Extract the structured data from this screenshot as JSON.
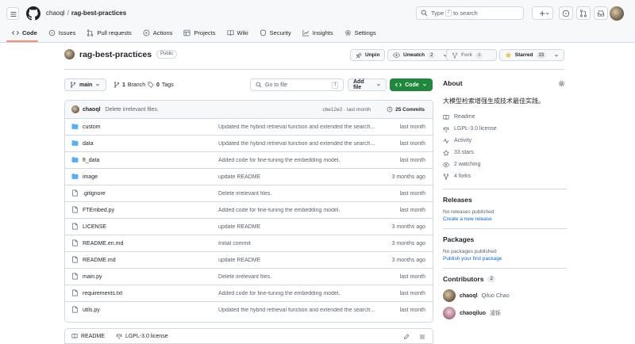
{
  "header": {
    "owner": "chaoql",
    "separator": "/",
    "repo": "rag-best-practices",
    "search_prefix": "Type",
    "search_key": "/",
    "search_suffix": "to search"
  },
  "tabs": [
    {
      "label": "Code",
      "icon": "code-icon"
    },
    {
      "label": "Issues",
      "icon": "issue-icon"
    },
    {
      "label": "Pull requests",
      "icon": "pull-request-icon"
    },
    {
      "label": "Actions",
      "icon": "play-icon"
    },
    {
      "label": "Projects",
      "icon": "table-icon"
    },
    {
      "label": "Wiki",
      "icon": "book-icon"
    },
    {
      "label": "Security",
      "icon": "shield-icon"
    },
    {
      "label": "Insights",
      "icon": "graph-icon"
    },
    {
      "label": "Settings",
      "icon": "gear-icon"
    }
  ],
  "repo": {
    "name": "rag-best-practices",
    "visibility": "Public",
    "unpin": "Unpin",
    "unwatch": "Unwatch",
    "watch_count": "2",
    "fork": "Fork",
    "fork_count": "4",
    "starred": "Starred",
    "star_count": "33"
  },
  "toolbar": {
    "branch": "main",
    "branches_num": "1",
    "branches_label": "Branch",
    "tags_num": "0",
    "tags_label": "Tags",
    "goto_placeholder": "Go to file",
    "goto_key": "t",
    "add_file": "Add file",
    "code": "Code"
  },
  "commit": {
    "author": "chaoql",
    "message": "Delete irrelevant files.",
    "meta": "cbe12e2 · last month",
    "count_label": "25 Commits"
  },
  "files": [
    {
      "name": "custom",
      "type": "dir",
      "message": "Updated the hybrid retrieval function and extended the search...",
      "date": "last month"
    },
    {
      "name": "data",
      "type": "dir",
      "message": "Updated the hybrid retrieval function and extended the search...",
      "date": "last month"
    },
    {
      "name": "ft_data",
      "type": "dir",
      "message": "Added code for fine-tuning the embedding model.",
      "date": "last month"
    },
    {
      "name": "image",
      "type": "dir",
      "message": "update README",
      "date": "3 months ago"
    },
    {
      "name": ".gitignore",
      "type": "file",
      "message": "Delete irrelevant files.",
      "date": "last month"
    },
    {
      "name": "FTEmbed.py",
      "type": "file",
      "message": "Added code for fine-tuning the embedding model.",
      "date": "last month"
    },
    {
      "name": "LICENSE",
      "type": "file",
      "message": "update README",
      "date": "3 months ago"
    },
    {
      "name": "README.en.md",
      "type": "file",
      "message": "Initial commit",
      "date": "3 months ago"
    },
    {
      "name": "README.md",
      "type": "file",
      "message": "update README",
      "date": "3 months ago"
    },
    {
      "name": "main.py",
      "type": "file",
      "message": "Delete irrelevant files.",
      "date": "last month"
    },
    {
      "name": "requirements.txt",
      "type": "file",
      "message": "Added code for fine-tuning the embedding model.",
      "date": "last month"
    },
    {
      "name": "utils.py",
      "type": "file",
      "message": "Updated the hybrid retrieval function and extended the search...",
      "date": "last month"
    }
  ],
  "readme_tabs": [
    "README",
    "LGPL-3.0 license"
  ],
  "about": {
    "title": "About",
    "description": "大模型检索增强生成技术最佳实践。",
    "readme": "Readme",
    "license": "LGPL-3.0 license",
    "activity": "Activity",
    "stars": "33 stars",
    "watching": "2 watching",
    "forks": "4 forks"
  },
  "releases": {
    "title": "Releases",
    "empty": "No releases published",
    "link": "Create a new release"
  },
  "packages": {
    "title": "Packages",
    "empty": "No packages published",
    "link": "Publish your first package"
  },
  "contributors": {
    "title": "Contributors",
    "count": "2",
    "list": [
      {
        "login": "chaoql",
        "name": "Qiluo Chao"
      },
      {
        "login": "chaoqiluo",
        "name": "凌铄"
      }
    ]
  },
  "colors": {
    "accent": "#0969da",
    "green": "#1f883d",
    "folder": "#54aeff",
    "tab_underline": "#fd8c73",
    "star": "#eac54f"
  }
}
